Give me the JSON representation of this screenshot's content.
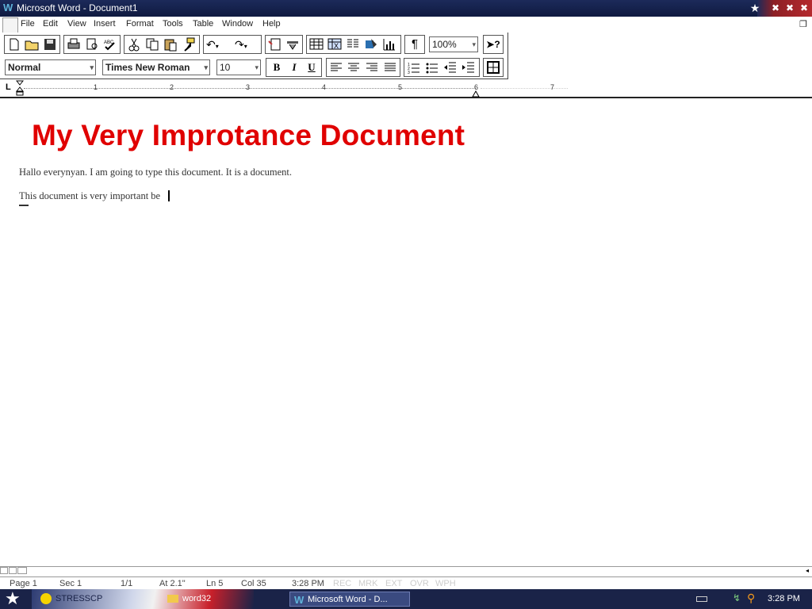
{
  "window": {
    "title": "Microsoft Word - Document1",
    "controls": [
      "★",
      "✖",
      "✖",
      "✖"
    ]
  },
  "menu": {
    "items": [
      "File",
      "Edit",
      "View",
      "Insert",
      "Format",
      "Tools",
      "Table",
      "Window",
      "Help"
    ]
  },
  "toolbar": {
    "zoom": "100%",
    "style": "Normal",
    "font": "Times New Roman",
    "size": "10",
    "bold": "B",
    "italic": "I",
    "underline": "U",
    "pilcrow": "¶",
    "help": "➤?"
  },
  "ruler": {
    "tab_marker": "L",
    "numbers": [
      "1",
      "2",
      "3",
      "4",
      "5",
      "6",
      "7"
    ]
  },
  "document": {
    "heading": "My Very Improtance Document",
    "paragraphs": [
      "Hallo everynyan. I am going to type this document. It is a document.",
      "This document is very important be"
    ]
  },
  "status": {
    "page": "Page 1",
    "sec": "Sec 1",
    "pages": "1/1",
    "at": "At 2.1\"",
    "ln": "Ln 5",
    "col": "Col 35",
    "time": "3:28 PM",
    "indicators": [
      "REC",
      "MRK",
      "EXT",
      "OVR",
      "WPH"
    ]
  },
  "taskbar": {
    "tasks": [
      "STRESSCP",
      "word32",
      "Microsoft Word - D..."
    ],
    "clock": "3:28 PM"
  },
  "colors": {
    "heading": "#e00000",
    "titlebar": "#1c2a5a",
    "taskbar": "#1a2348"
  }
}
